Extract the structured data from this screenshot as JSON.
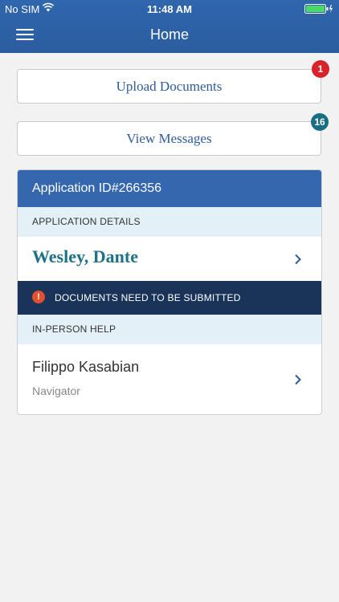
{
  "status_bar": {
    "carrier": "No SIM",
    "time": "11:48 AM"
  },
  "header": {
    "title": "Home"
  },
  "actions": {
    "upload_label": "Upload Documents",
    "upload_badge": "1",
    "messages_label": "View Messages",
    "messages_badge": "16"
  },
  "application": {
    "id_title": "Application ID#266356",
    "details_label": "APPLICATION DETAILS",
    "applicant_name": "Wesley, Dante",
    "alert_text": "DOCUMENTS NEED TO BE SUBMITTED",
    "help_label": "IN-PERSON HELP",
    "navigator_name": "Filippo Kasabian",
    "navigator_role": "Navigator"
  },
  "colors": {
    "header_blue": "#2f66ad",
    "accent_teal": "#1e7187",
    "alert_navy": "#1a3359",
    "badge_red": "#d9232a",
    "battery_green": "#4cd964"
  },
  "icons": [
    "wifi-icon",
    "battery-icon",
    "menu-icon",
    "chevron-right-icon",
    "alert-icon"
  ]
}
